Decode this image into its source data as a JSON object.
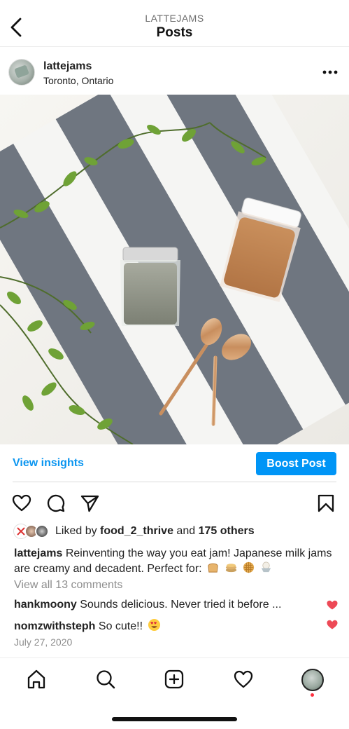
{
  "header": {
    "subtitle": "LATTEJAMS",
    "title": "Posts"
  },
  "post": {
    "username": "lattejams",
    "location": "Toronto, Ontario",
    "image_alt": "Two jars of milk jam with gold spoons on a striped towel surrounded by greenery",
    "view_insights": "View insights",
    "boost_label": "Boost Post",
    "liked_prefix": "Liked by",
    "liked_user": "food_2_thrive",
    "liked_and": "and",
    "liked_others": "175 others",
    "caption_user": "lattejams",
    "caption_text": "Reinventing the way you eat jam! Japanese milk jams are creamy and decadent. Perfect for:",
    "caption_emojis": [
      "bread-icon",
      "pancakes-icon",
      "waffle-icon",
      "ice-cream-icon"
    ],
    "view_comments": "View all 13 comments",
    "comments": [
      {
        "user": "hankmoony",
        "text": "Sounds delicious.  Never tried it before ..."
      },
      {
        "user": "nomzwithsteph",
        "text": "So cute!!"
      }
    ],
    "date": "July 27, 2020"
  },
  "colors": {
    "accent": "#0095f6",
    "heart": "#ed4956",
    "notification": "#ff3040"
  }
}
